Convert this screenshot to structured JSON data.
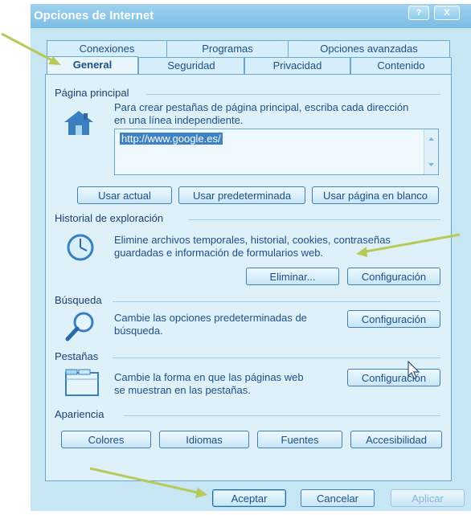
{
  "window": {
    "title": "Opciones de Internet",
    "help_label": "?",
    "close_label": "X"
  },
  "tabs": {
    "row1": [
      "Conexiones",
      "Programas",
      "Opciones avanzadas"
    ],
    "row2": [
      "General",
      "Seguridad",
      "Privacidad",
      "Contenido"
    ]
  },
  "home": {
    "section": "Página principal",
    "description_line1": "Para crear pestañas de página principal, escriba cada dirección",
    "description_line2": "en una línea independiente.",
    "url": "http://www.google.es/",
    "buttons": [
      "Usar actual",
      "Usar predeterminada",
      "Usar página en blanco"
    ]
  },
  "history": {
    "section": "Historial de exploración",
    "description_line1": "Elimine archivos temporales, historial, cookies, contraseñas",
    "description_line2": "guardadas e información de formularios web.",
    "delete_label": "Eliminar...",
    "settings_label": "Configuración"
  },
  "search": {
    "section": "Búsqueda",
    "description_line1": "Cambie las opciones predeterminadas de",
    "description_line2": "búsqueda.",
    "settings_label": "Configuración"
  },
  "tabs_section": {
    "section": "Pestañas",
    "description_line1": "Cambie la forma en que las páginas web",
    "description_line2": "se muestran en las pestañas.",
    "settings_label": "Configuración"
  },
  "appearance": {
    "section": "Apariencia",
    "buttons": [
      "Colores",
      "Idiomas",
      "Fuentes",
      "Accesibilidad"
    ]
  },
  "footer": {
    "ok": "Aceptar",
    "cancel": "Cancelar",
    "apply": "Aplicar"
  }
}
